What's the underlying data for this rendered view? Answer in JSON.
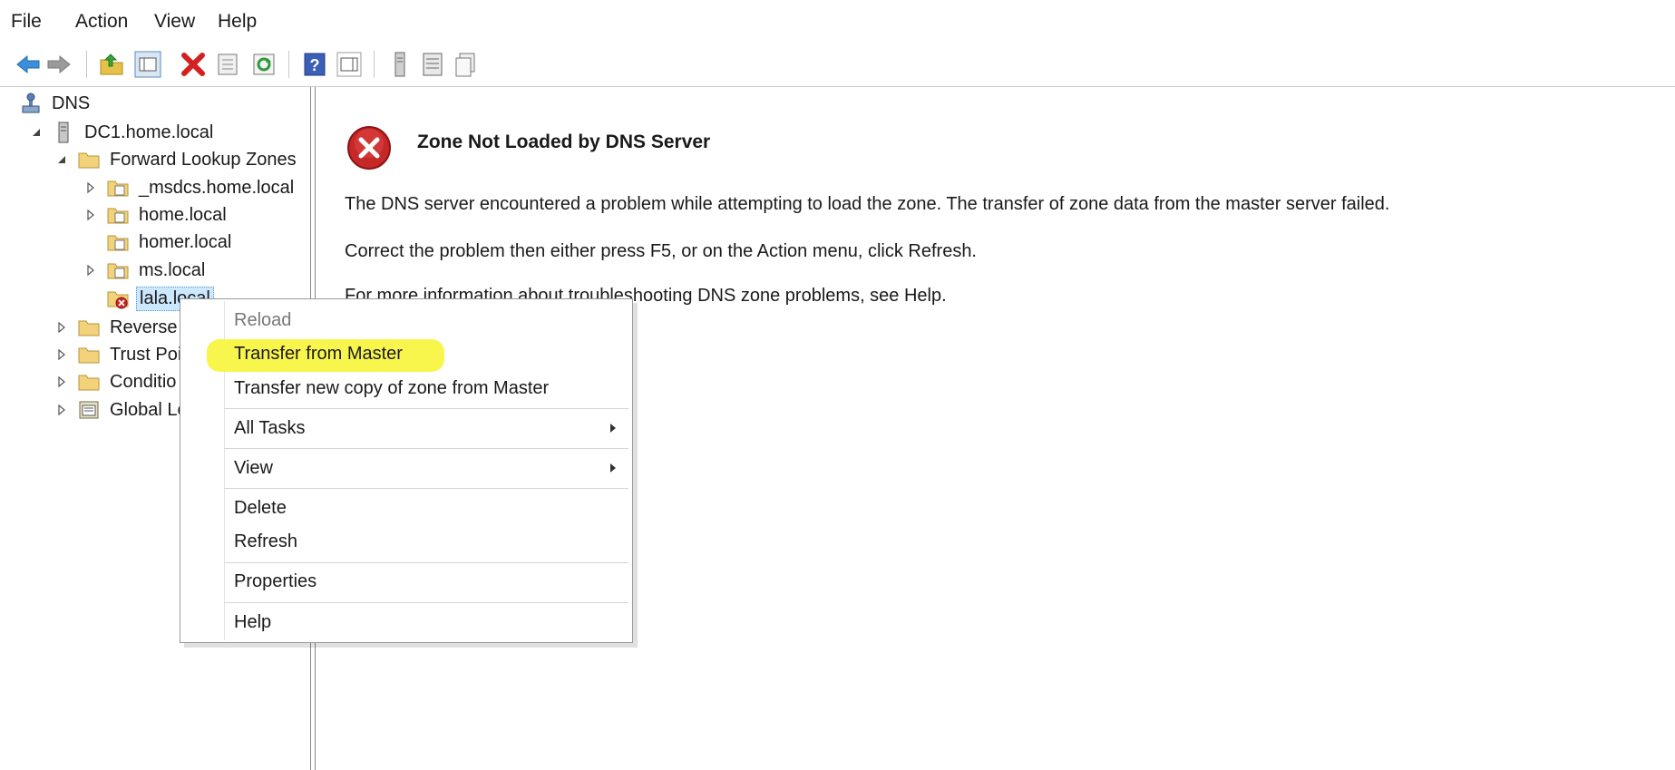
{
  "menubar": {
    "items": [
      "File",
      "Action",
      "View",
      "Help"
    ]
  },
  "toolbar": {
    "icons": [
      "back-arrow-icon",
      "forward-arrow-icon",
      "up-folder-icon",
      "show-hide-console-tree-icon",
      "delete-icon",
      "properties-icon",
      "refresh-icon",
      "help-icon",
      "show-hide-action-pane-icon",
      "server-icon",
      "list-icon",
      "copy-icon"
    ]
  },
  "tree": {
    "root": "DNS",
    "server": "DC1.home.local",
    "forward_zones": "Forward Lookup Zones",
    "zones": [
      "_msdcs.home.local",
      "home.local",
      "homer.local",
      "ms.local",
      "lala.local"
    ],
    "reverse": "Reverse L",
    "trust": "Trust Poi",
    "conditional": "Conditio",
    "global": "Global Lo"
  },
  "content": {
    "title": "Zone Not Loaded by DNS Server",
    "line1": "The DNS server encountered a problem while attempting to load the zone. The transfer of zone data from the master server failed.",
    "line2": "Correct the problem then either press F5, or on the Action menu, click Refresh.",
    "line3": "For more information about troubleshooting DNS zone problems, see Help."
  },
  "context_menu": {
    "reload": "Reload",
    "transfer": "Transfer from Master",
    "transfer_new": "Transfer new copy of zone from Master",
    "all_tasks": "All Tasks",
    "view": "View",
    "delete": "Delete",
    "refresh": "Refresh",
    "properties": "Properties",
    "help": "Help"
  },
  "colors": {
    "highlight": "#f7f43a",
    "error_red": "#c62828",
    "selection": "#cce8ff"
  }
}
